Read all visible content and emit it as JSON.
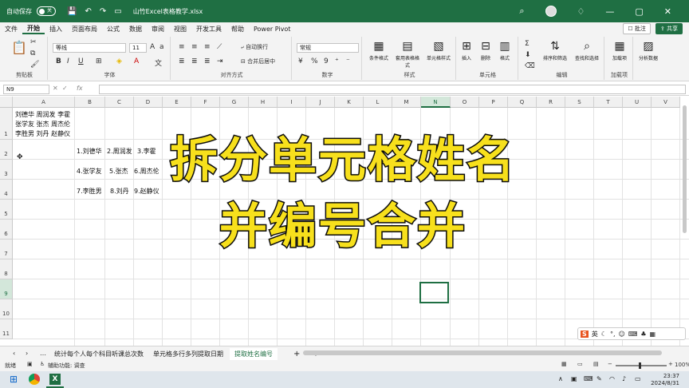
{
  "titlebar": {
    "autosave_label": "自动保存",
    "autosave_state": "关",
    "file_title": "山竹Excel表格教学.xlsx"
  },
  "menu": {
    "items": [
      "文件",
      "开始",
      "插入",
      "页面布局",
      "公式",
      "数据",
      "审阅",
      "视图",
      "开发工具",
      "帮助",
      "Power Pivot"
    ],
    "active_index": 1,
    "comments": "批注",
    "share": "共享"
  },
  "ribbon": {
    "font_name": "等线",
    "font_size": "11",
    "number_format": "常规",
    "wrap_text": "自动换行",
    "merge_center": "合并后居中",
    "conditional_format": "条件格式",
    "format_table": "套用表格格式",
    "cell_styles": "单元格样式",
    "insert": "插入",
    "delete": "删除",
    "format": "格式",
    "sort_filter": "排序和筛选",
    "find_select": "查找和选择",
    "load_items": "加载项",
    "analyze": "分析数据",
    "groups": [
      "剪贴板",
      "字体",
      "对齐方式",
      "数字",
      "样式",
      "单元格",
      "编辑",
      "加载项"
    ]
  },
  "formula_bar": {
    "name_box": "N9",
    "fx": "fx"
  },
  "sheet": {
    "columns": [
      "A",
      "B",
      "C",
      "D",
      "E",
      "F",
      "G",
      "H",
      "I",
      "J",
      "K",
      "L",
      "M",
      "N",
      "O",
      "P",
      "Q",
      "R",
      "S",
      "T",
      "U",
      "V"
    ],
    "rows": [
      "1",
      "2",
      "3",
      "4",
      "5",
      "6",
      "7",
      "8",
      "9",
      "10",
      "11"
    ],
    "selected_column": "N",
    "selected_row": "9",
    "cells": {
      "a1": "刘德华 周润发 李霍\n张学友 张杰 周杰伦\n李胜男 刘丹 赵静仪",
      "b2": "1.刘德华",
      "c2": "2.周润发",
      "d2": "3.李霍",
      "b3": "4.张学友",
      "c3": "5.张杰",
      "d3": "6.周杰伦",
      "b4": "7.李胜男",
      "c4": "8.刘丹",
      "d4": "9.赵静仪"
    }
  },
  "overlay": {
    "line1": "拆分单元格姓名",
    "line2": "并编号合并",
    "color": "#f7e01c"
  },
  "tabs": {
    "items": [
      "统计每个人每个科目听课总次数",
      "单元格多行多列提取日期",
      "提取姓名编号"
    ],
    "active_index": 2
  },
  "status": {
    "ready": "就绪",
    "accessibility": "辅助功能: 调查",
    "zoom": "100%"
  },
  "taskbar": {
    "time": "23:37",
    "date": "2024/8/31"
  },
  "ime": {
    "label": "英"
  }
}
